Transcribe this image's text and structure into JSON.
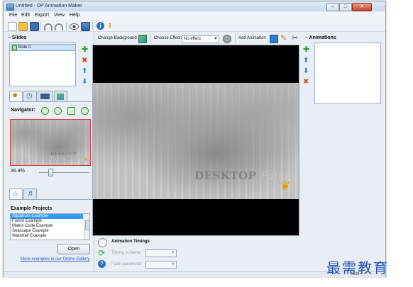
{
  "window": {
    "title": "Untitled - DP Animation Maker",
    "controls": {
      "minimize": "–",
      "maximize": "□",
      "close": "✕"
    }
  },
  "menu": [
    "File",
    "Edit",
    "Export",
    "View",
    "Help"
  ],
  "slides": {
    "title": "Slides",
    "items": [
      {
        "label": "Slide 0",
        "selected": true
      }
    ]
  },
  "canvas_toolbar": {
    "change_background": "Change Background",
    "choose_effect_label": "Choose Effect:",
    "effect_value": "No effect",
    "add_animation": "Add Animation"
  },
  "animations": {
    "title": "Animations"
  },
  "navigator": {
    "label": "Navigator:",
    "zoom_value": "36.9%"
  },
  "watermark": {
    "word1": "DESKTOP",
    "word2": "Paints"
  },
  "examples": {
    "title": "Example Projects",
    "items": [
      {
        "label": "Aquarium Example",
        "selected": true
      },
      {
        "label": "Forest Example",
        "selected": false
      },
      {
        "label": "Matrix Code Example",
        "selected": false
      },
      {
        "label": "Seascape Example",
        "selected": false
      },
      {
        "label": "Waterfall Example",
        "selected": false
      }
    ],
    "open_button": "Open",
    "gallery_link": "More examples in our Online Gallery"
  },
  "timings": {
    "title": "Animation Timings",
    "timing_scheme_label": "Timing scheme:",
    "fade_parameter_label": "Fade parameter:"
  },
  "status": {
    "num": "NUM"
  },
  "site_watermark": "最需教育",
  "colors": {
    "accent": "#3399ff",
    "titlebar": "#c9d9ec",
    "close": "#c2432b",
    "link": "#2a55c8"
  }
}
